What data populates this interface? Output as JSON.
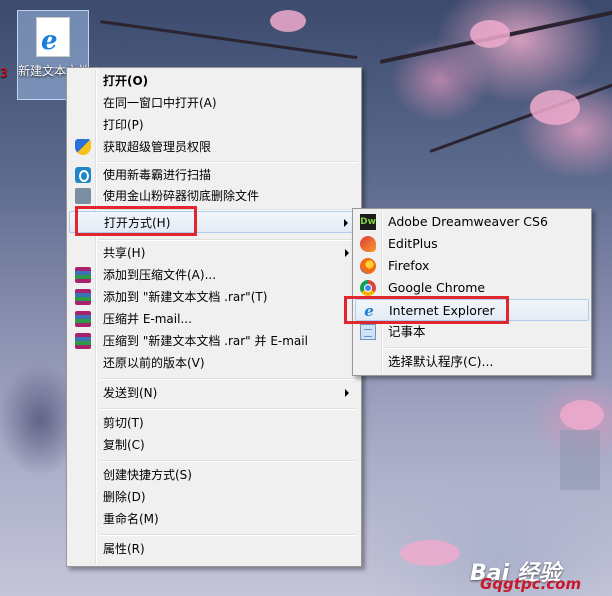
{
  "desktop": {
    "icon_label": "新建文本文档 .htm",
    "left_edge_text": "3"
  },
  "context_menu": {
    "items": [
      {
        "label": "打开(O)",
        "bold": true
      },
      {
        "label": "在同一窗口中打开(A)"
      },
      {
        "label": "打印(P)"
      },
      {
        "label": "获取超级管理员权限",
        "icon": "uac-shield-icon"
      },
      {
        "label": "使用新毒霸进行扫描",
        "icon": "antivirus-scan-icon"
      },
      {
        "label": "使用金山粉碎器彻底删除文件",
        "icon": "file-shredder-icon"
      },
      {
        "label": "打开方式(H)",
        "submenu": true
      },
      {
        "label": "共享(H)",
        "submenu": true
      },
      {
        "label": "添加到压缩文件(A)...",
        "icon": "winrar-icon"
      },
      {
        "label": "添加到 \"新建文本文档 .rar\"(T)",
        "icon": "winrar-icon"
      },
      {
        "label": "压缩并 E-mail...",
        "icon": "winrar-icon"
      },
      {
        "label": "压缩到 \"新建文本文档 .rar\" 并 E-mail",
        "icon": "winrar-icon"
      },
      {
        "label": "还原以前的版本(V)"
      },
      {
        "label": "发送到(N)",
        "submenu": true
      },
      {
        "label": "剪切(T)"
      },
      {
        "label": "复制(C)"
      },
      {
        "label": "创建快捷方式(S)"
      },
      {
        "label": "删除(D)"
      },
      {
        "label": "重命名(M)"
      },
      {
        "label": "属性(R)"
      }
    ]
  },
  "open_with_submenu": {
    "items": [
      {
        "label": "Adobe Dreamweaver CS6",
        "icon": "dreamweaver-icon",
        "icon_text": "Dw"
      },
      {
        "label": "EditPlus",
        "icon": "editplus-icon"
      },
      {
        "label": "Firefox",
        "icon": "firefox-icon"
      },
      {
        "label": "Google Chrome",
        "icon": "chrome-icon"
      },
      {
        "label": "Internet Explorer",
        "icon": "internet-explorer-icon",
        "icon_text": "e"
      },
      {
        "label": "记事本",
        "icon": "notepad-icon"
      },
      {
        "label": "选择默认程序(C)..."
      }
    ]
  },
  "watermark": {
    "line1": "Bai 经验",
    "line2": "Gqgtpc.com"
  },
  "colors": {
    "highlight_red": "#e0262f",
    "menu_bg": "#f0f0f0",
    "hover_border": "#aeccf0"
  }
}
